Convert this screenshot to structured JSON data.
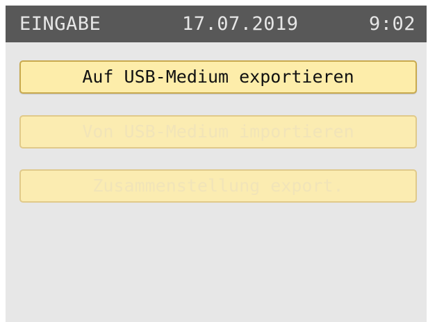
{
  "header": {
    "title": "EINGABE",
    "date": "17.07.2019",
    "time": "9:02"
  },
  "menu": {
    "items": [
      {
        "label": "Auf USB-Medium exportieren",
        "enabled": true
      },
      {
        "label": "Von USB-Medium importieren",
        "enabled": false
      },
      {
        "label": "Zusammenstellung export.",
        "enabled": false
      }
    ]
  },
  "colors": {
    "header_bg": "#585858",
    "screen_bg": "#e7e7e7",
    "button_bg": "#fdedaa",
    "button_border": "#c8a94e"
  }
}
